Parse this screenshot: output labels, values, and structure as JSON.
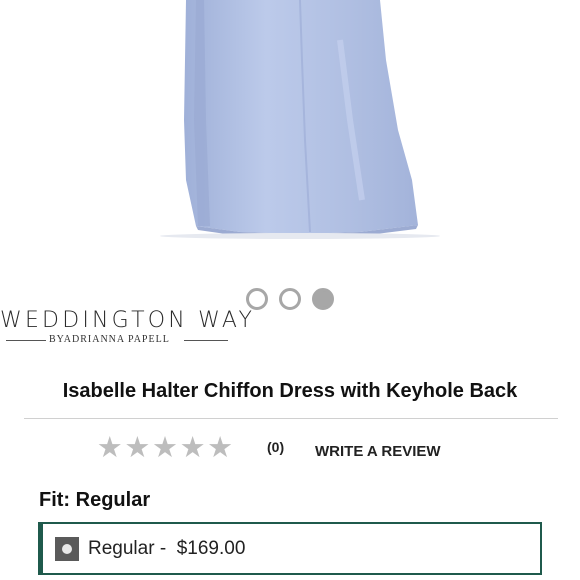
{
  "carousel": {
    "total": 3,
    "active_index": 2
  },
  "brand": {
    "name": "WEDDINGTON WAY",
    "byline": "BYADRIANNA PAPELL"
  },
  "product": {
    "title": "Isabelle Halter Chiffon Dress with Keyhole Back"
  },
  "reviews": {
    "stars_filled": 0,
    "stars_total": 5,
    "count": "(0)",
    "write_label": "WRITE A REVIEW"
  },
  "fit": {
    "label": "Fit: Regular",
    "options": [
      {
        "label": "Regular -  $169.00",
        "selected": true
      }
    ]
  },
  "colors": {
    "dress": "#b3c2e3",
    "option_border": "#1f5a4c",
    "star": "#bdbdbd",
    "dot": "#a7a7a7"
  }
}
